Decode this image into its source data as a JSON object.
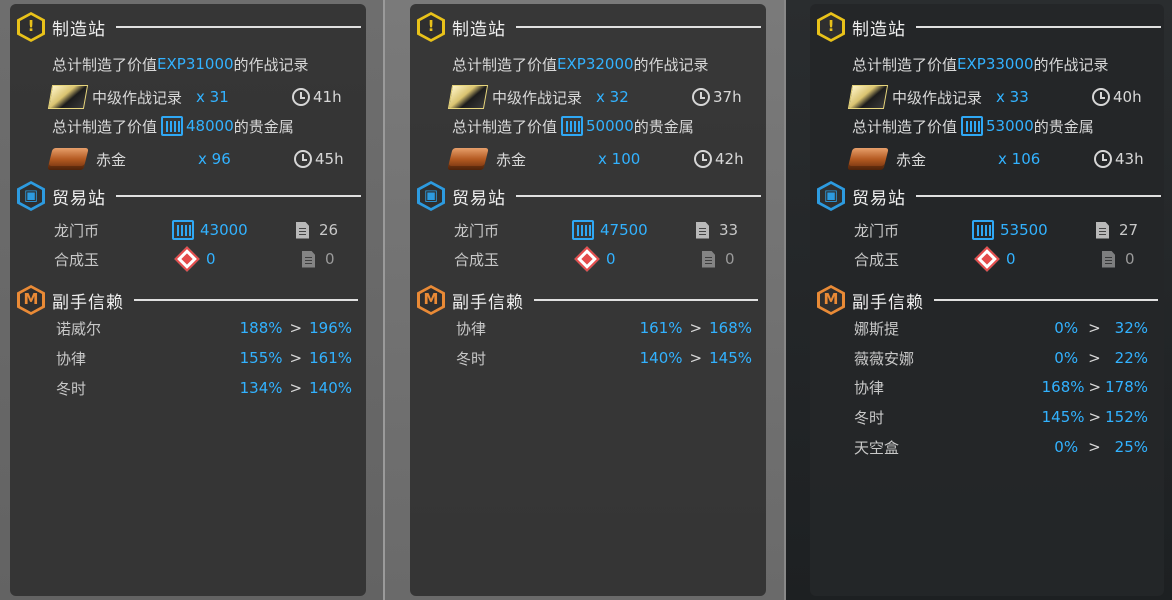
{
  "panels": [
    {
      "manufacture": {
        "title": "制造站",
        "exp_summary": {
          "prefix": "总计制造了价值",
          "value": "EXP31000",
          "suffix": "的作战记录"
        },
        "record": {
          "name": "中级作战记录",
          "qty": "x 31",
          "time": "41h"
        },
        "gold_summary": {
          "prefix": "总计制造了价值",
          "value": "48000",
          "suffix": "的贵金属"
        },
        "gold": {
          "name": "赤金",
          "qty": "x 96",
          "time": "45h"
        }
      },
      "trade": {
        "title": "贸易站",
        "lmd": {
          "name": "龙门币",
          "value": "43000",
          "count": "26"
        },
        "orundum": {
          "name": "合成玉",
          "value": "0",
          "count": "0"
        }
      },
      "trust": {
        "title": "副手信赖",
        "rows": [
          {
            "name": "诺威尔",
            "from": "188%",
            "to": "196%"
          },
          {
            "name": "协律",
            "from": "155%",
            "to": "161%"
          },
          {
            "name": "冬时",
            "from": "134%",
            "to": "140%"
          }
        ]
      }
    },
    {
      "manufacture": {
        "title": "制造站",
        "exp_summary": {
          "prefix": "总计制造了价值",
          "value": "EXP32000",
          "suffix": "的作战记录"
        },
        "record": {
          "name": "中级作战记录",
          "qty": "x 32",
          "time": "37h"
        },
        "gold_summary": {
          "prefix": "总计制造了价值",
          "value": "50000",
          "suffix": "的贵金属"
        },
        "gold": {
          "name": "赤金",
          "qty": "x 100",
          "time": "42h"
        }
      },
      "trade": {
        "title": "贸易站",
        "lmd": {
          "name": "龙门币",
          "value": "47500",
          "count": "33"
        },
        "orundum": {
          "name": "合成玉",
          "value": "0",
          "count": "0"
        }
      },
      "trust": {
        "title": "副手信赖",
        "rows": [
          {
            "name": "协律",
            "from": "161%",
            "to": "168%"
          },
          {
            "name": "冬时",
            "from": "140%",
            "to": "145%"
          }
        ]
      }
    },
    {
      "manufacture": {
        "title": "制造站",
        "exp_summary": {
          "prefix": "总计制造了价值",
          "value": "EXP33000",
          "suffix": "的作战记录"
        },
        "record": {
          "name": "中级作战记录",
          "qty": "x 33",
          "time": "40h"
        },
        "gold_summary": {
          "prefix": "总计制造了价值",
          "value": "53000",
          "suffix": "的贵金属"
        },
        "gold": {
          "name": "赤金",
          "qty": "x 106",
          "time": "43h"
        }
      },
      "trade": {
        "title": "贸易站",
        "lmd": {
          "name": "龙门币",
          "value": "53500",
          "count": "27"
        },
        "orundum": {
          "name": "合成玉",
          "value": "0",
          "count": "0"
        }
      },
      "trust": {
        "title": "副手信赖",
        "rows": [
          {
            "name": "娜斯提",
            "from": "0%",
            "to": "32%"
          },
          {
            "name": "薇薇安娜",
            "from": "0%",
            "to": "22%"
          },
          {
            "name": "协律",
            "from": "168%",
            "to": "178%"
          },
          {
            "name": "冬时",
            "from": "145%",
            "to": "152%"
          },
          {
            "name": "天空盒",
            "from": "0%",
            "to": "25%"
          }
        ]
      }
    }
  ],
  "symbols": {
    "arrow": ">",
    "alert": "!",
    "trust_glyph": "M"
  },
  "colors": {
    "accent_blue": "#32b2ff",
    "manufacture_icon": "#e9c21a",
    "trade_icon": "#2d9be0",
    "trust_icon": "#e98a36"
  }
}
